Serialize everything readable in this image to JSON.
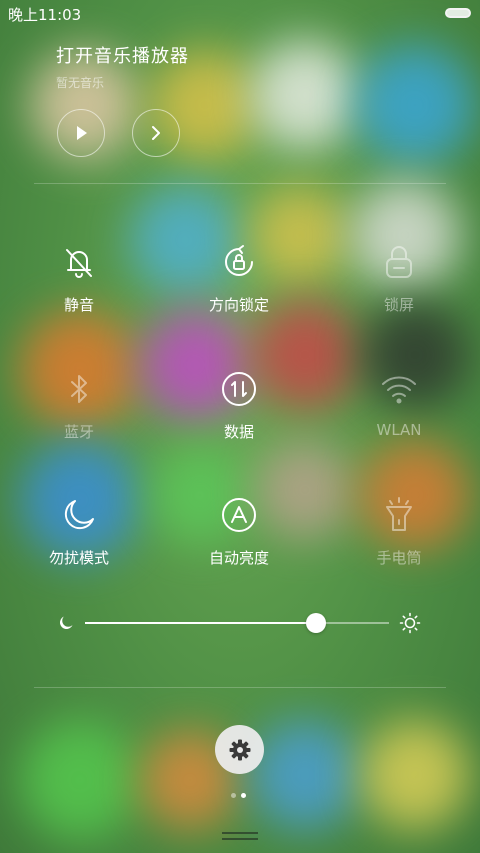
{
  "status_bar": {
    "time": "晚上11:03"
  },
  "music": {
    "title": "打开音乐播放器",
    "subtitle": "暂无音乐"
  },
  "toggles": [
    {
      "label": "静音",
      "icon": "bell-off-icon",
      "active": true
    },
    {
      "label": "方向锁定",
      "icon": "rotation-lock-icon",
      "active": true
    },
    {
      "label": "锁屏",
      "icon": "lock-icon",
      "active": false
    },
    {
      "label": "蓝牙",
      "icon": "bluetooth-icon",
      "active": false
    },
    {
      "label": "数据",
      "icon": "data-transfer-icon",
      "active": true
    },
    {
      "label": "WLAN",
      "icon": "wifi-icon",
      "active": false
    },
    {
      "label": "勿扰模式",
      "icon": "moon-icon",
      "active": true
    },
    {
      "label": "自动亮度",
      "icon": "auto-brightness-icon",
      "active": true
    },
    {
      "label": "手电筒",
      "icon": "flashlight-icon",
      "active": false
    }
  ],
  "brightness": {
    "level": 0.76
  },
  "pager": {
    "count": 2,
    "active": 1
  },
  "colors": {
    "active_dot": "#ffffff",
    "inactive_dot": "rgba(255,255,255,0.45)",
    "settings_icon": "#3a3a3a"
  }
}
